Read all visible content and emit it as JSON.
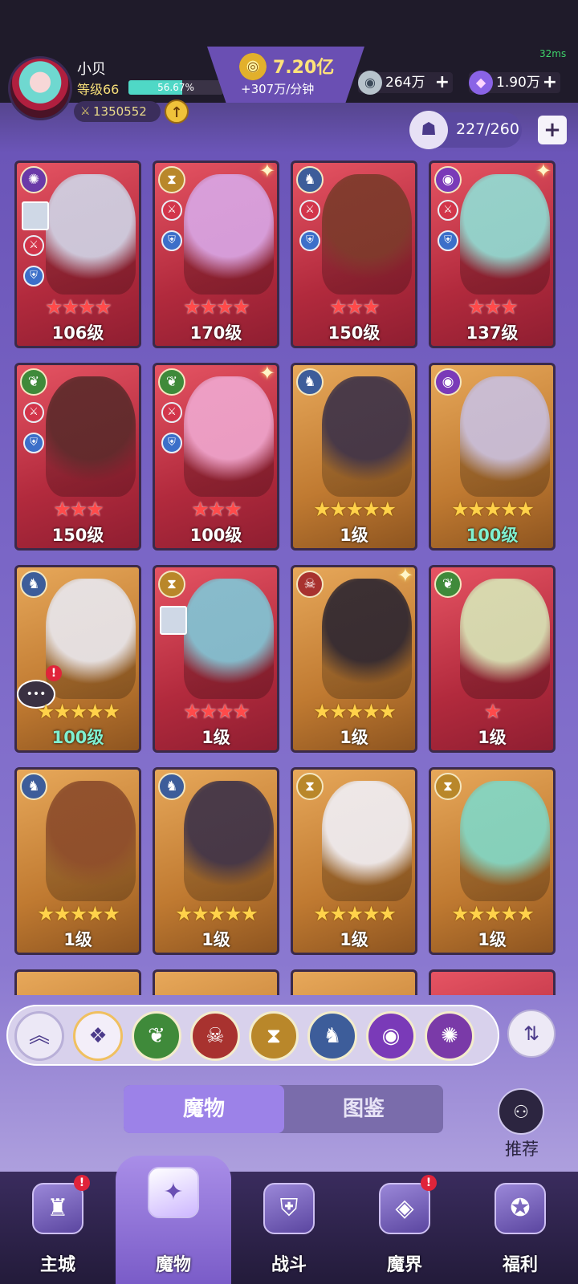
{
  "status": {
    "ping": "32ms"
  },
  "player": {
    "name": "小贝",
    "level": "等级66",
    "xp_percent": "56.67%",
    "xp_fraction": 0.5667,
    "power": "1350552"
  },
  "gold": {
    "value": "7.20亿",
    "rate": "+307万/分钟"
  },
  "resources": [
    {
      "icon": "crystal-coin-icon",
      "value": "264万"
    },
    {
      "icon": "prism-gem-icon",
      "value": "1.90万"
    }
  ],
  "capacity": {
    "text": "227/260"
  },
  "cards": [
    {
      "element": "fire",
      "rarity": "red",
      "stars": 4,
      "level": "106级",
      "badges": [
        "sword",
        "shield"
      ],
      "mini": true
    },
    {
      "element": "time",
      "rarity": "red",
      "stars": 4,
      "level": "170级",
      "badges": [
        "sword",
        "shield"
      ],
      "spark": true
    },
    {
      "element": "dragon",
      "rarity": "red",
      "stars": 3,
      "level": "150级",
      "badges": [
        "sword",
        "shield"
      ]
    },
    {
      "element": "eye",
      "rarity": "red",
      "stars": 3,
      "level": "137级",
      "badges": [
        "sword",
        "shield"
      ],
      "spark": true
    },
    {
      "element": "leaf",
      "rarity": "red",
      "stars": 3,
      "level": "150级",
      "badges": [
        "sword",
        "shield"
      ]
    },
    {
      "element": "leaf",
      "rarity": "red",
      "stars": 3,
      "level": "100级",
      "badges": [
        "sword",
        "shield"
      ],
      "spark": true
    },
    {
      "element": "dragon",
      "rarity": "gold",
      "stars": 5,
      "level": "1级"
    },
    {
      "element": "eye",
      "rarity": "gold",
      "stars": 5,
      "level": "100级",
      "teal": true
    },
    {
      "element": "dragon",
      "rarity": "gold",
      "stars": 5,
      "level": "100级",
      "teal": true,
      "chat": true
    },
    {
      "element": "time",
      "rarity": "red",
      "stars": 4,
      "level": "1级",
      "mini": true
    },
    {
      "element": "demon",
      "rarity": "gold",
      "stars": 5,
      "level": "1级",
      "spark": true
    },
    {
      "element": "leaf",
      "rarity": "red",
      "stars": 1,
      "level": "1级"
    },
    {
      "element": "dragon",
      "rarity": "gold",
      "stars": 5,
      "level": "1级"
    },
    {
      "element": "dragon",
      "rarity": "gold",
      "stars": 5,
      "level": "1级"
    },
    {
      "element": "time",
      "rarity": "gold",
      "stars": 5,
      "level": "1级"
    },
    {
      "element": "time",
      "rarity": "gold",
      "stars": 5,
      "level": "1级"
    }
  ],
  "filters": [
    "collapse",
    "all",
    "leaf",
    "demon",
    "time",
    "dragon",
    "eye",
    "fire"
  ],
  "tabs": {
    "monsters": "魔物",
    "codex": "图鉴"
  },
  "recommend": "推荐",
  "nav": [
    {
      "label": "主城",
      "icon": "castle-icon",
      "alert": true
    },
    {
      "label": "魔物",
      "icon": "flame-icon",
      "active": true
    },
    {
      "label": "战斗",
      "icon": "shield-sword-icon"
    },
    {
      "label": "魔界",
      "icon": "portal-icon",
      "alert": true
    },
    {
      "label": "福利",
      "icon": "chest-icon"
    }
  ]
}
